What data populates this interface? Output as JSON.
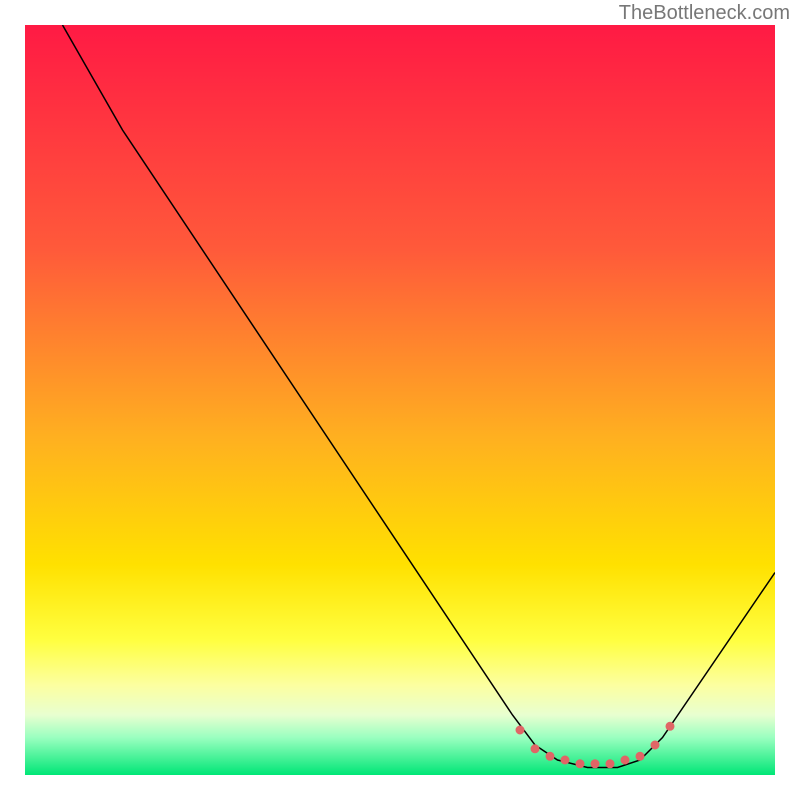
{
  "attribution": "TheBottleneck.com",
  "chart_data": {
    "type": "line",
    "title": "",
    "xlabel": "",
    "ylabel": "",
    "xlim": [
      0,
      100
    ],
    "ylim": [
      0,
      100
    ],
    "series": [
      {
        "name": "curve",
        "points": [
          {
            "x": 5,
            "y": 100
          },
          {
            "x": 9,
            "y": 93
          },
          {
            "x": 13,
            "y": 86
          },
          {
            "x": 65,
            "y": 8
          },
          {
            "x": 68,
            "y": 4
          },
          {
            "x": 71,
            "y": 2
          },
          {
            "x": 75,
            "y": 1
          },
          {
            "x": 79,
            "y": 1
          },
          {
            "x": 82,
            "y": 2
          },
          {
            "x": 85,
            "y": 5
          },
          {
            "x": 100,
            "y": 27
          }
        ]
      },
      {
        "name": "dots",
        "points": [
          {
            "x": 66,
            "y": 6
          },
          {
            "x": 68,
            "y": 3.5
          },
          {
            "x": 70,
            "y": 2.5
          },
          {
            "x": 72,
            "y": 2
          },
          {
            "x": 74,
            "y": 1.5
          },
          {
            "x": 76,
            "y": 1.5
          },
          {
            "x": 78,
            "y": 1.5
          },
          {
            "x": 80,
            "y": 2
          },
          {
            "x": 82,
            "y": 2.5
          },
          {
            "x": 84,
            "y": 4
          },
          {
            "x": 86,
            "y": 6.5
          }
        ]
      }
    ],
    "background_gradient": {
      "top": "#ff1a44",
      "middle": "#ffe100",
      "bottom": "#00e676"
    }
  }
}
